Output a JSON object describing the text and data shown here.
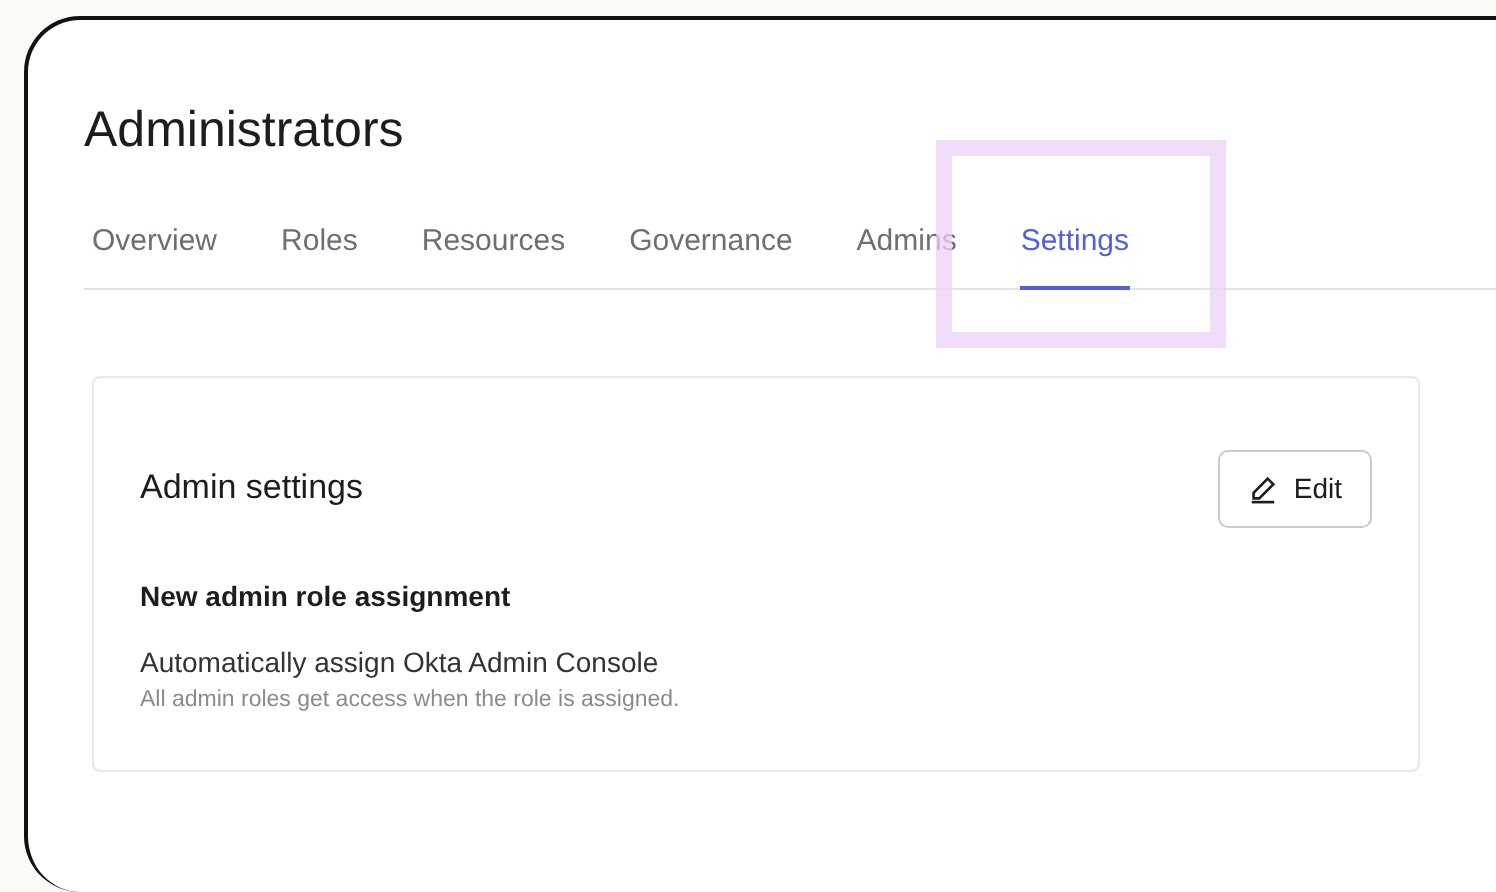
{
  "page": {
    "title": "Administrators"
  },
  "tabs": [
    {
      "label": "Overview",
      "selected": false,
      "highlighted": false
    },
    {
      "label": "Roles",
      "selected": false,
      "highlighted": false
    },
    {
      "label": "Resources",
      "selected": false,
      "highlighted": false
    },
    {
      "label": "Governance",
      "selected": false,
      "highlighted": false
    },
    {
      "label": "Admins",
      "selected": false,
      "highlighted": false
    },
    {
      "label": "Settings",
      "selected": true,
      "highlighted": true
    }
  ],
  "card": {
    "title": "Admin settings",
    "edit_button": "Edit",
    "section_title": "New admin role assignment",
    "setting_label": "Automatically assign Okta Admin Console",
    "setting_help": "All admin roles get access when the role is assigned."
  }
}
